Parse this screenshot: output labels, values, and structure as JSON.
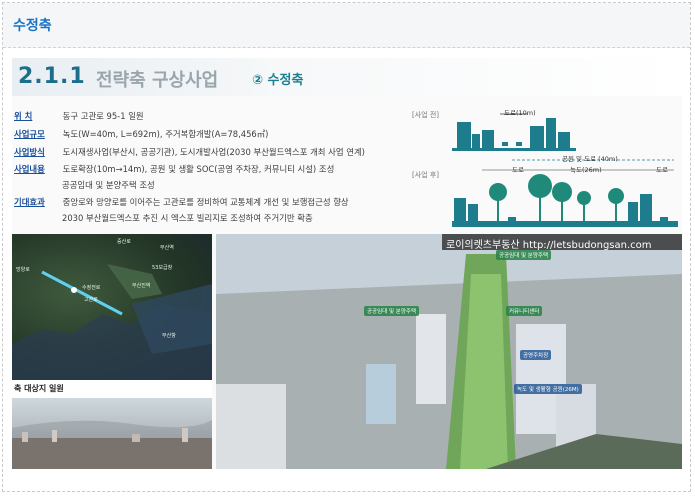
{
  "panel": {
    "title": "수정축"
  },
  "slide": {
    "section_number": "2.1.1",
    "section_title": "전략축 구상사업",
    "section_badge": "② 수정축",
    "info": [
      {
        "key": "위    치",
        "value": "동구 고관로 95-1 일원"
      },
      {
        "key": "사업규모",
        "value": "녹도(W=40m, L=692m), 주거복합개발(A=78,456㎡)"
      },
      {
        "key": "사업방식",
        "value": "도시재생사업(부산시, 공공기관), 도시개발사업(2030 부산월드엑스포 개최 사업 연계)"
      },
      {
        "key": "사업내용",
        "value": "도로확장(10m→14m), 공원 및 생활 SOC(공영 주차장, 커뮤니티 시설) 조성"
      },
      {
        "key": "",
        "value": "공공임대 및 분양주택 조성"
      },
      {
        "key": "기대효과",
        "value": "중앙로와 망양로를 이어주는 고관로를 정비하여 교통체계 개선 및 보행접근성 향상"
      },
      {
        "key": "",
        "value": "2030 부산월드엑스포 추진 시 엑스포 빌리지로 조성하여 주거기반 확충"
      }
    ],
    "diagram": {
      "before_tag": "[사업 전]",
      "after_tag": "[사업 후]",
      "road_10m": "도로(10m)",
      "park_road_40m": "공원 및 도로 (40m)",
      "road_left": "도로",
      "green_26m": "녹도(26m)",
      "road_right": "도로"
    },
    "caption": "축 대상지 일원",
    "watermark": "로이의렛츠부동산 http://letsbudongsan.com",
    "map_labels": [
      "증산로",
      "망양로",
      "부산역",
      "수정전로",
      "부산진역",
      "고관로",
      "부산항",
      "53보급창"
    ],
    "render_labels": [
      "공공임대 및 분양주택",
      "공공임대 및 분양주택",
      "커뮤니티센터",
      "공영주차장",
      "녹도 및 생활형 공원(26M)"
    ]
  }
}
